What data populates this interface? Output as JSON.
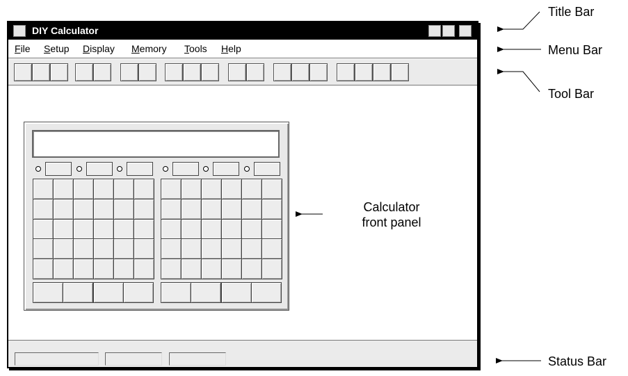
{
  "window": {
    "title": "DIY Calculator",
    "menu": [
      {
        "label": "File",
        "accel": "F",
        "rest": "ile"
      },
      {
        "label": "Setup",
        "accel": "S",
        "rest": "etup"
      },
      {
        "label": "Display",
        "accel": "D",
        "rest": "isplay"
      },
      {
        "label": "Memory",
        "accel": "M",
        "rest": "emory"
      },
      {
        "label": "Tools",
        "accel": "T",
        "rest": "ools"
      },
      {
        "label": "Help",
        "accel": "H",
        "rest": "elp"
      }
    ]
  },
  "annotations": {
    "title_bar": "Title Bar",
    "menu_bar": "Menu Bar",
    "tool_bar": "Tool Bar",
    "front_panel_line1": "Calculator",
    "front_panel_line2": "front panel",
    "status_bar": "Status Bar"
  },
  "colors": {
    "title_bar": "#000000",
    "panel": "#e9e9e9",
    "bar": "#ebebeb"
  }
}
